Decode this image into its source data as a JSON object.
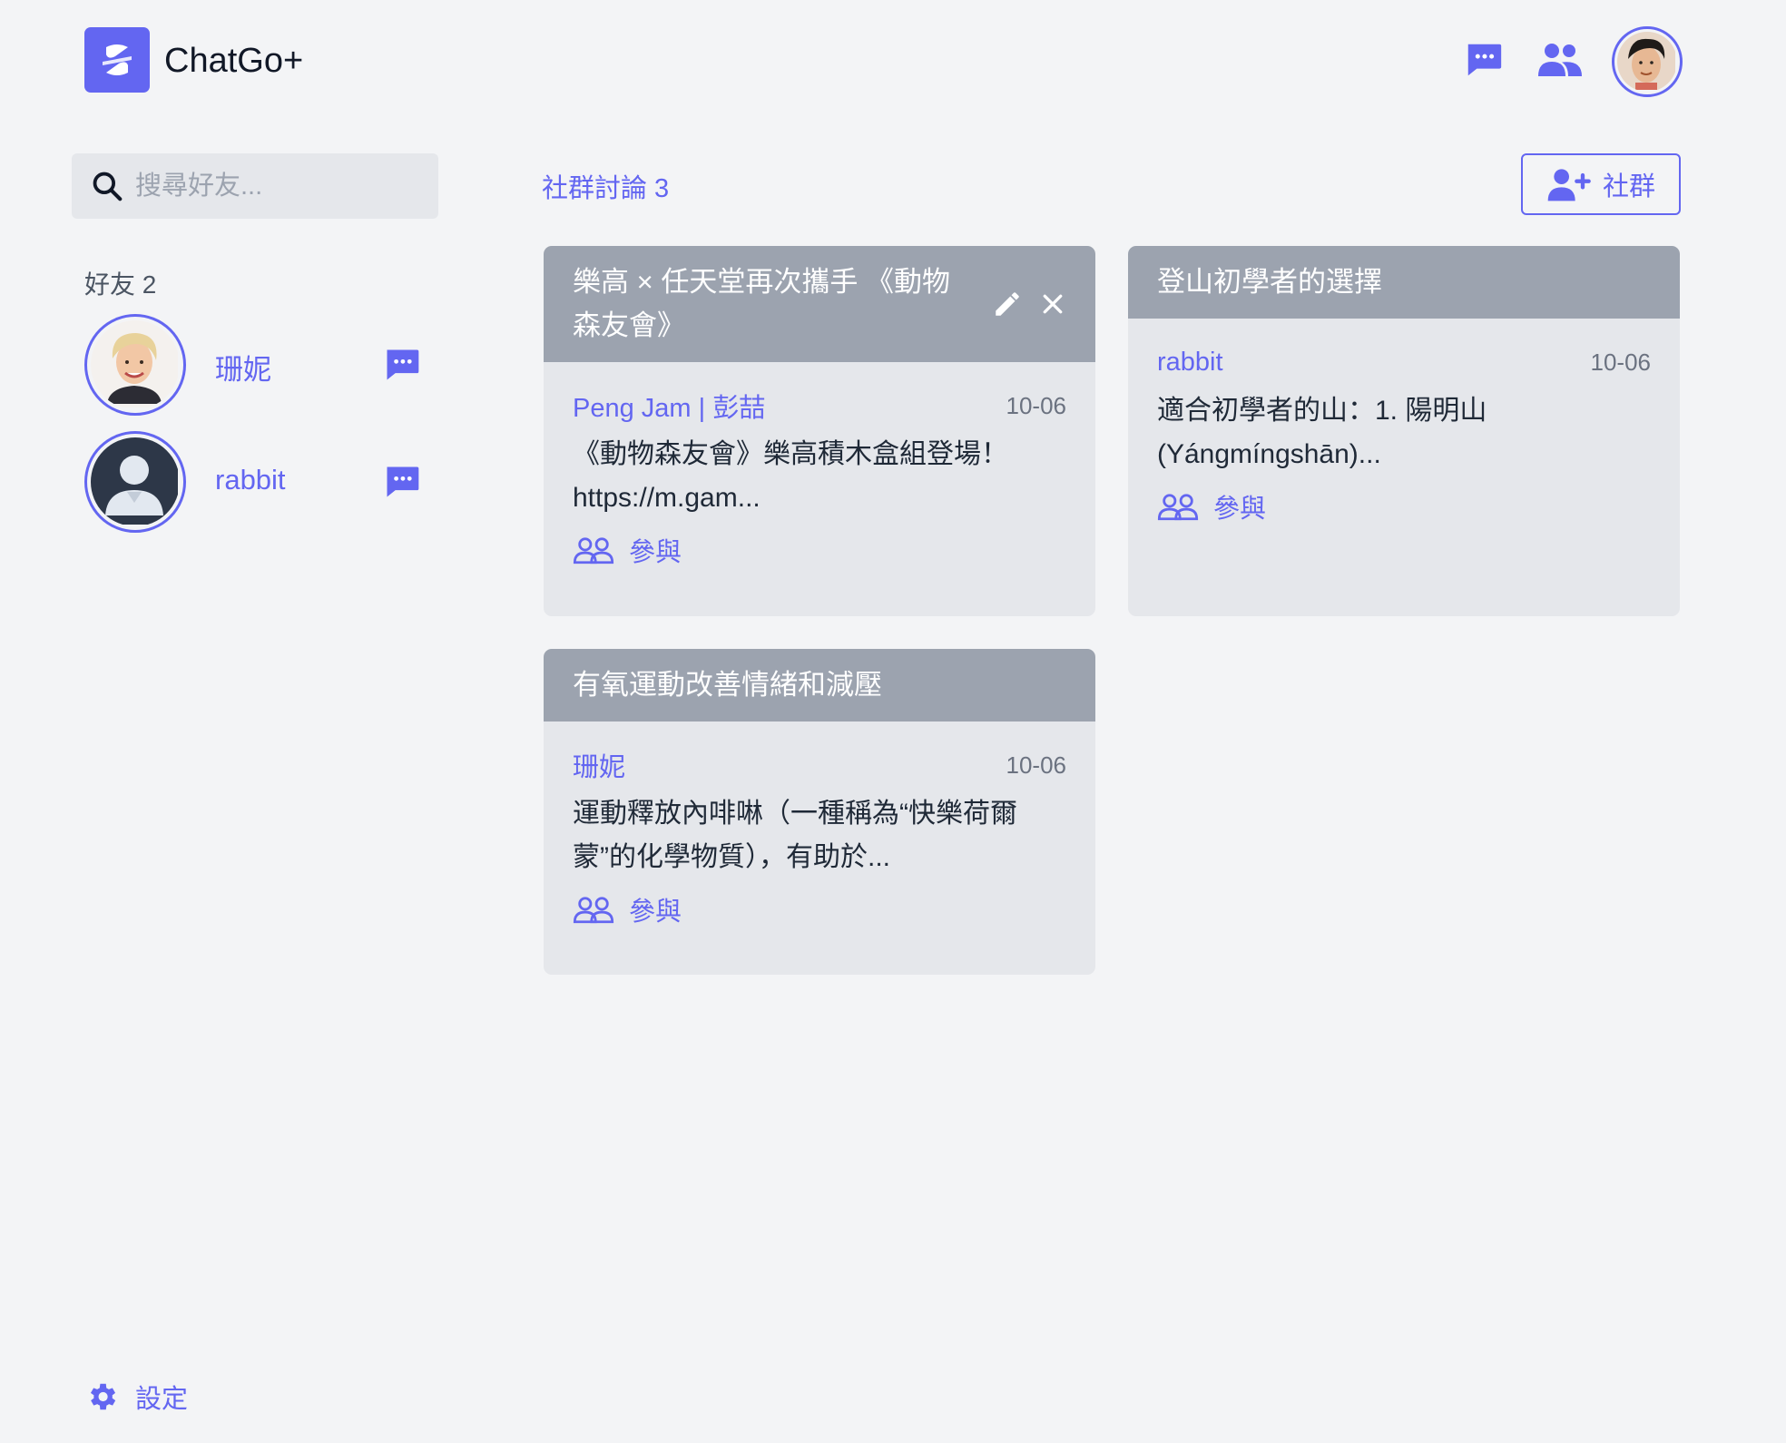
{
  "header": {
    "app_name": "ChatGo+"
  },
  "sidebar": {
    "search_placeholder": "搜尋好友...",
    "friends_title": "好友 2",
    "friends": [
      {
        "name": "珊妮"
      },
      {
        "name": "rabbit"
      }
    ],
    "settings_label": "設定"
  },
  "main": {
    "title": "社群討論 3",
    "add_button_label": "社群",
    "cards": [
      {
        "title": "樂高 × 任天堂再次攜手 《動物森友會》",
        "author": "Peng Jam | 彭喆",
        "date": "10-06",
        "excerpt": "《動物森友會》樂高積木盒組登場！https://m.gam...",
        "join_label": "參與"
      },
      {
        "title": "登山初學者的選擇",
        "author": "rabbit",
        "date": "10-06",
        "excerpt": "適合初學者的山：1. 陽明山 (Yángmíngshān)...",
        "join_label": "參與"
      },
      {
        "title": "有氧運動改善情緒和減壓",
        "author": "珊妮",
        "date": "10-06",
        "excerpt": "運動釋放內啡啉（一種稱為“快樂荷爾蒙”的化學物質），有助於...",
        "join_label": "參與"
      }
    ]
  },
  "colors": {
    "accent": "#6366f1",
    "card_header": "#9ca3af",
    "card_body": "#e5e7eb",
    "background": "#f3f4f6"
  }
}
